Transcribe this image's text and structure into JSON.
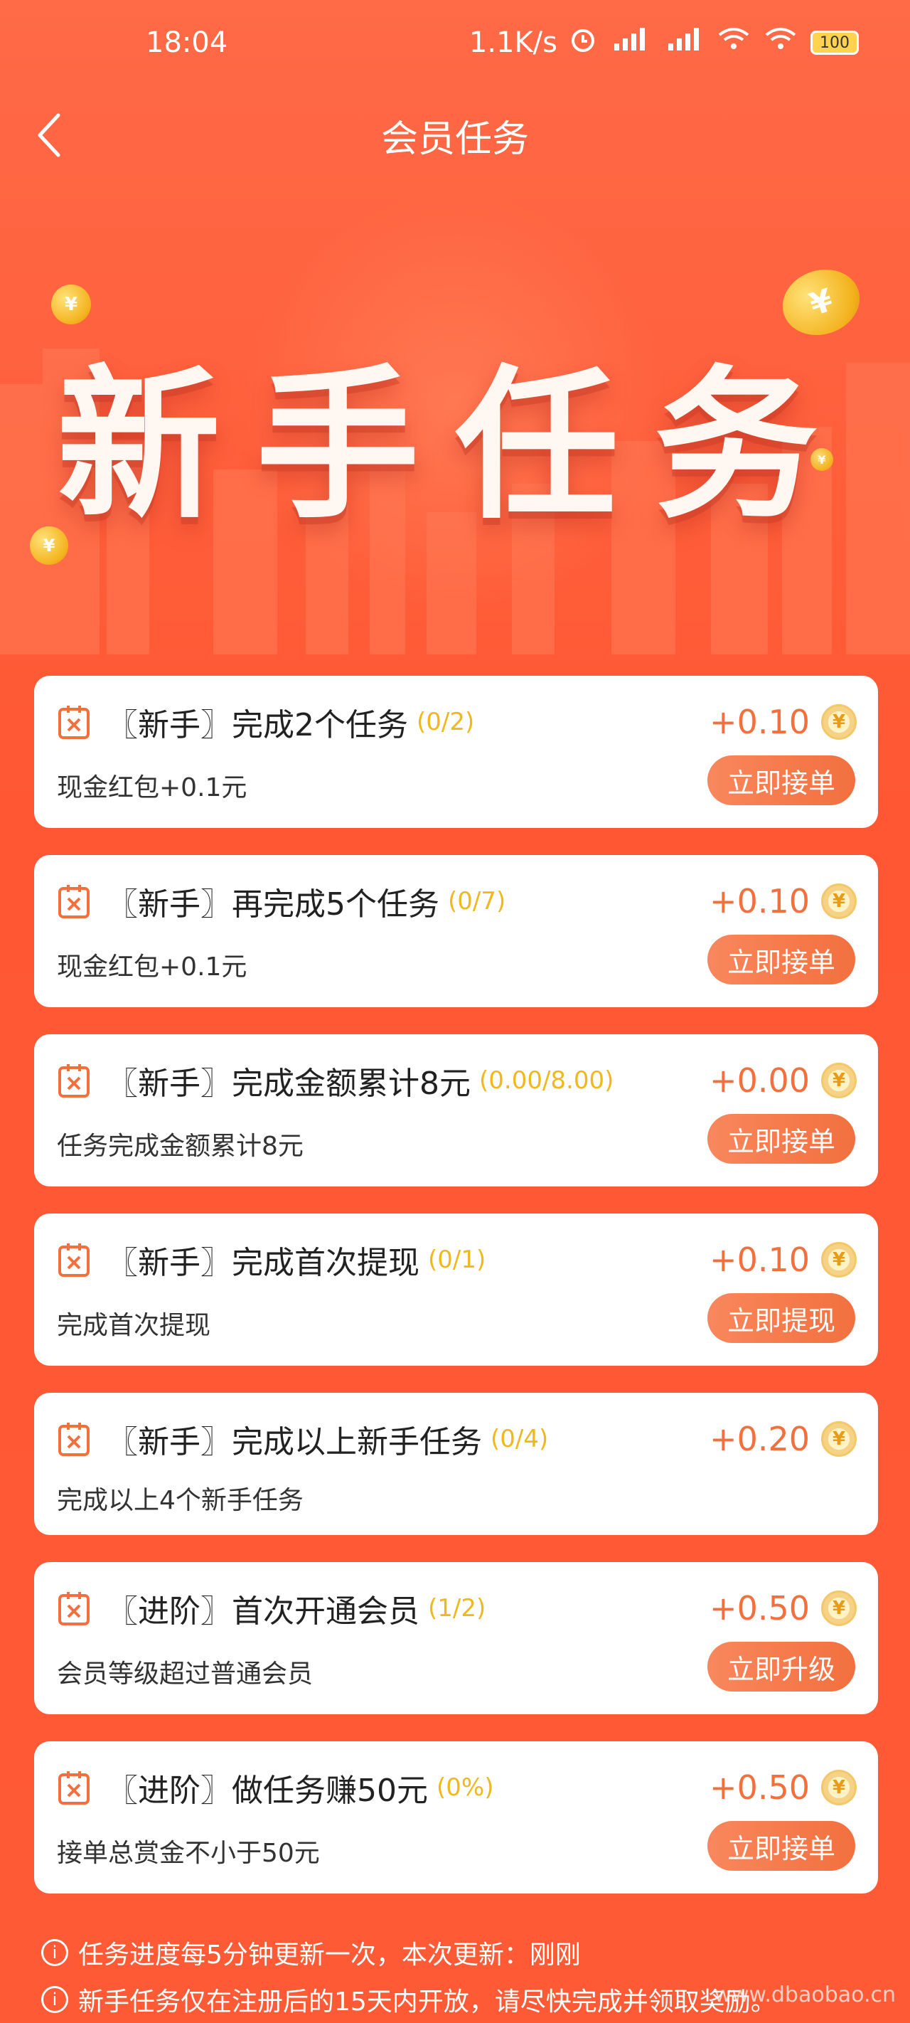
{
  "status_bar": {
    "time": "18:04",
    "net_speed": "1.1K/s",
    "battery": "100",
    "icons": [
      "alarm-icon",
      "hd-signal-icon",
      "hd-signal-icon",
      "wifi-plus-icon",
      "wifi-icon",
      "battery-icon"
    ]
  },
  "nav": {
    "title": "会员任务",
    "back_icon": "chevron-left-icon"
  },
  "banner": {
    "title": "新手任务"
  },
  "tasks": [
    {
      "title": "〖新手〗完成2个任务",
      "progress": "(0/2)",
      "reward": "+0.10",
      "desc": "现金红包+0.1元",
      "button": "立即接单"
    },
    {
      "title": "〖新手〗再完成5个任务",
      "progress": "(0/7)",
      "reward": "+0.10",
      "desc": "现金红包+0.1元",
      "button": "立即接单"
    },
    {
      "title": "〖新手〗完成金额累计8元",
      "progress": "(0.00/8.00)",
      "reward": "+0.00",
      "desc": "任务完成金额累计8元",
      "button": "立即接单"
    },
    {
      "title": "〖新手〗完成首次提现",
      "progress": "(0/1)",
      "reward": "+0.10",
      "desc": "完成首次提现",
      "button": "立即提现"
    },
    {
      "title": "〖新手〗完成以上新手任务",
      "progress": "(0/4)",
      "reward": "+0.20",
      "desc": "完成以上4个新手任务",
      "button": ""
    },
    {
      "title": "〖进阶〗首次开通会员",
      "progress": "(1/2)",
      "reward": "+0.50",
      "desc": "会员等级超过普通会员",
      "button": "立即升级"
    },
    {
      "title": "〖进阶〗做任务赚50元",
      "progress": "(0%)",
      "reward": "+0.50",
      "desc": "接单总赏金不小于50元",
      "button": "立即接单"
    }
  ],
  "notes": [
    "任务进度每5分钟更新一次，本次更新：刚刚",
    "新手任务仅在注册后的15天内开放，请尽快完成并领取奖励。"
  ],
  "watermark": "www.dbaobao.cn",
  "colors": {
    "background": "#ff5733",
    "reward": "#f2703e",
    "progress": "#f0b81d",
    "button": "#f2703e"
  }
}
